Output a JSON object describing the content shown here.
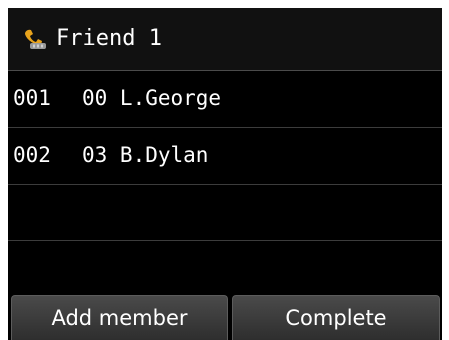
{
  "header": {
    "icon": "handset-group-icon",
    "title": "Friend 1"
  },
  "members": [
    {
      "number": "001",
      "name": "00 L.George"
    },
    {
      "number": "002",
      "name": "03 B.Dylan"
    },
    {
      "number": "",
      "name": ""
    },
    {
      "number": "",
      "name": ""
    }
  ],
  "buttons": {
    "add_member": "Add member",
    "complete": "Complete"
  },
  "colors": {
    "background": "#000000",
    "text": "#ffffff",
    "icon_accent": "#e8a31c"
  }
}
